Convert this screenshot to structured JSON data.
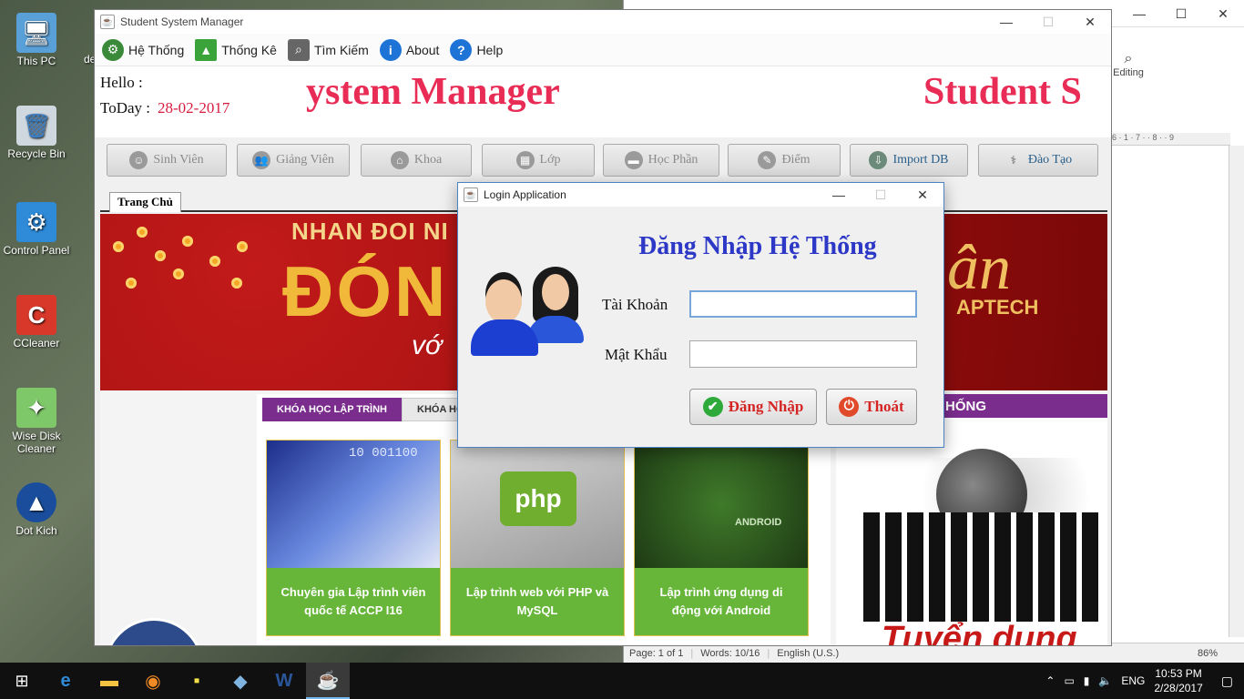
{
  "desktop": {
    "icons": [
      {
        "label": "This PC",
        "glyph": "🖥"
      },
      {
        "label": "Recycle Bin",
        "glyph": "🗑"
      },
      {
        "label": "Control Panel",
        "glyph": "⚙"
      },
      {
        "label": "CCleaner",
        "glyph": "C"
      },
      {
        "label": "Wise Disk Cleaner",
        "glyph": "✦"
      },
      {
        "label": "Dot Kich",
        "glyph": "▲"
      }
    ],
    "partial_label": "de"
  },
  "word": {
    "editing_label": "Editing",
    "ruler_text": "6 · 1 · 7 · · 8 · · 9",
    "status": {
      "page": "Page: 1 of 1",
      "words": "Words: 10/16",
      "lang": "English (U.S.)",
      "zoom": "86%"
    }
  },
  "app": {
    "title": "Student System Manager",
    "menu": [
      {
        "label": "Hệ Thống",
        "icon": "gear-icon",
        "glyph": "⚙",
        "color": "#3a8a3a"
      },
      {
        "label": "Thống Kê",
        "icon": "chart-icon",
        "glyph": "▲",
        "color": "#3aa33a"
      },
      {
        "label": "Tìm Kiếm",
        "icon": "search-icon",
        "glyph": "⌕",
        "color": "#555555"
      },
      {
        "label": "About",
        "icon": "info-icon",
        "glyph": "i",
        "color": "#1e73d6"
      },
      {
        "label": "Help",
        "icon": "help-icon",
        "glyph": "?",
        "color": "#1e73d6"
      }
    ],
    "hello_label": "Hello :",
    "today_label": "ToDay :",
    "today_value": "28-02-2017",
    "marquee_left": "ystem Manager",
    "marquee_right": "Student S",
    "toolbar": [
      {
        "label": "Sinh Viên",
        "glyph": "☺"
      },
      {
        "label": "Giảng Viên",
        "glyph": "👥"
      },
      {
        "label": "Khoa",
        "glyph": "⌂"
      },
      {
        "label": "Lớp",
        "glyph": "▦"
      },
      {
        "label": "Học Phần",
        "glyph": "▬"
      },
      {
        "label": "Điểm",
        "glyph": "✎"
      },
      {
        "label": "Import DB",
        "glyph": "⇩"
      },
      {
        "label": "Đào Tạo",
        "glyph": "⚕"
      }
    ],
    "home_tab": "Trang Chủ",
    "banner": {
      "line1": "NHAN ĐOI NI",
      "line2": "ĐÓN",
      "line3": "vớ",
      "right1": "ân",
      "right2": "APTECH"
    },
    "course_tabs": [
      "KHÓA HỌC LẬP TRÌNH",
      "KHÓA HỌC"
    ],
    "cards": [
      {
        "caption": "Chuyên gia Lập trình viên quốc tế ACCP I16",
        "img_text": "10 001100"
      },
      {
        "caption": "Lập trình web với PHP và MySQL",
        "img_text": "php"
      },
      {
        "caption": "Lập trình ứng dụng di động với Android",
        "img_text": "ANDROID"
      }
    ],
    "right_panel_head": "HỐNG",
    "recruit_text": "Tuyển dụng"
  },
  "login": {
    "title": "Login Application",
    "heading": "Đăng Nhập Hệ Thống",
    "username_label": "Tài Khoản",
    "password_label": "Mật Khẩu",
    "username_value": "",
    "password_value": "",
    "login_button": "Đăng Nhập",
    "exit_button": "Thoát"
  },
  "taskbar": {
    "lang": "ENG",
    "time": "10:53 PM",
    "date": "2/28/2017"
  },
  "colors": {
    "accent_red": "#e82c55",
    "heading_blue": "#2d38c7",
    "card_green": "#67b63a",
    "tab_purple": "#7b2d8e"
  }
}
